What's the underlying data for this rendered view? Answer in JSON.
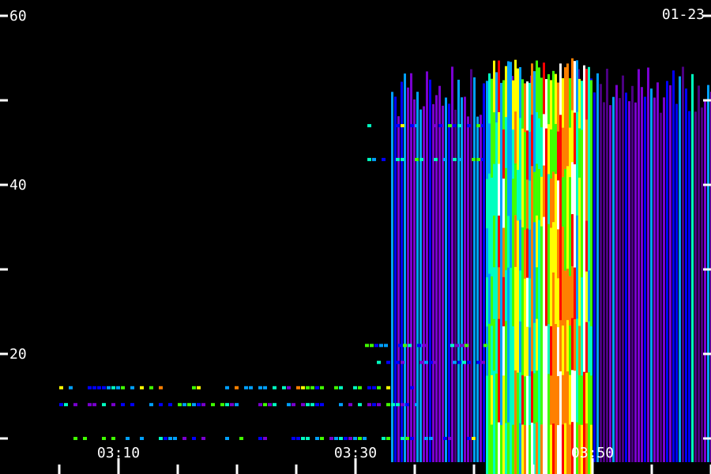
{
  "chart_data": {
    "type": "heatmap",
    "date_label": "01-23",
    "y_ticks": [
      {
        "value": 60,
        "label": "60"
      },
      {
        "value": 50,
        "label": ""
      },
      {
        "value": 40,
        "label": "40"
      },
      {
        "value": 30,
        "label": ""
      },
      {
        "value": 20,
        "label": "20"
      },
      {
        "value": 10,
        "label": ""
      }
    ],
    "ylim": [
      10,
      60
    ],
    "x_ticks": [
      {
        "value": "03:10",
        "label": "03:10"
      },
      {
        "value": "03:30",
        "label": "03:30"
      },
      {
        "value": "03:50",
        "label": "03:50"
      }
    ],
    "x_minor_ticks": [
      "03:05",
      "03:10",
      "03:15",
      "03:20",
      "03:25",
      "03:30",
      "03:35",
      "03:40",
      "03:45",
      "03:50",
      "03:55",
      "04:00"
    ],
    "xlim": [
      "03:05",
      "04:01"
    ],
    "colormap": [
      "#000000",
      "#4b0082",
      "#7a00d0",
      "#0000ff",
      "#00a0ff",
      "#00ffc0",
      "#40ff00",
      "#ffff00",
      "#ff8000",
      "#ff0000",
      "#ffffff"
    ],
    "features": [
      {
        "name": "burst",
        "t_start": "03:41",
        "t_end": "03:50",
        "f_low": 10,
        "f_high": 55,
        "intensity": 1.0
      },
      {
        "name": "diffuse emission",
        "t_start": "03:33",
        "t_end": "04:01",
        "f_low": 10,
        "f_high": 54,
        "intensity": 0.35
      },
      {
        "name": "narrowband line",
        "t_start": "03:05",
        "t_end": "03:36",
        "f": 16,
        "intensity": 0.45
      },
      {
        "name": "narrowband line",
        "t_start": "03:05",
        "t_end": "03:36",
        "f": 14,
        "intensity": 0.35
      },
      {
        "name": "narrowband line",
        "t_start": "03:05",
        "t_end": "03:40",
        "f": 10,
        "intensity": 0.4
      },
      {
        "name": "narrowband line",
        "t_start": "03:31",
        "t_end": "03:41",
        "f": 47,
        "intensity": 0.4
      },
      {
        "name": "narrowband line",
        "t_start": "03:31",
        "t_end": "03:41",
        "f": 43,
        "intensity": 0.4
      },
      {
        "name": "narrowband line",
        "t_start": "03:30",
        "t_end": "03:41",
        "f": 21,
        "intensity": 0.35
      },
      {
        "name": "narrowband line",
        "t_start": "03:31",
        "t_end": "03:41",
        "f": 19,
        "intensity": 0.35
      }
    ]
  }
}
